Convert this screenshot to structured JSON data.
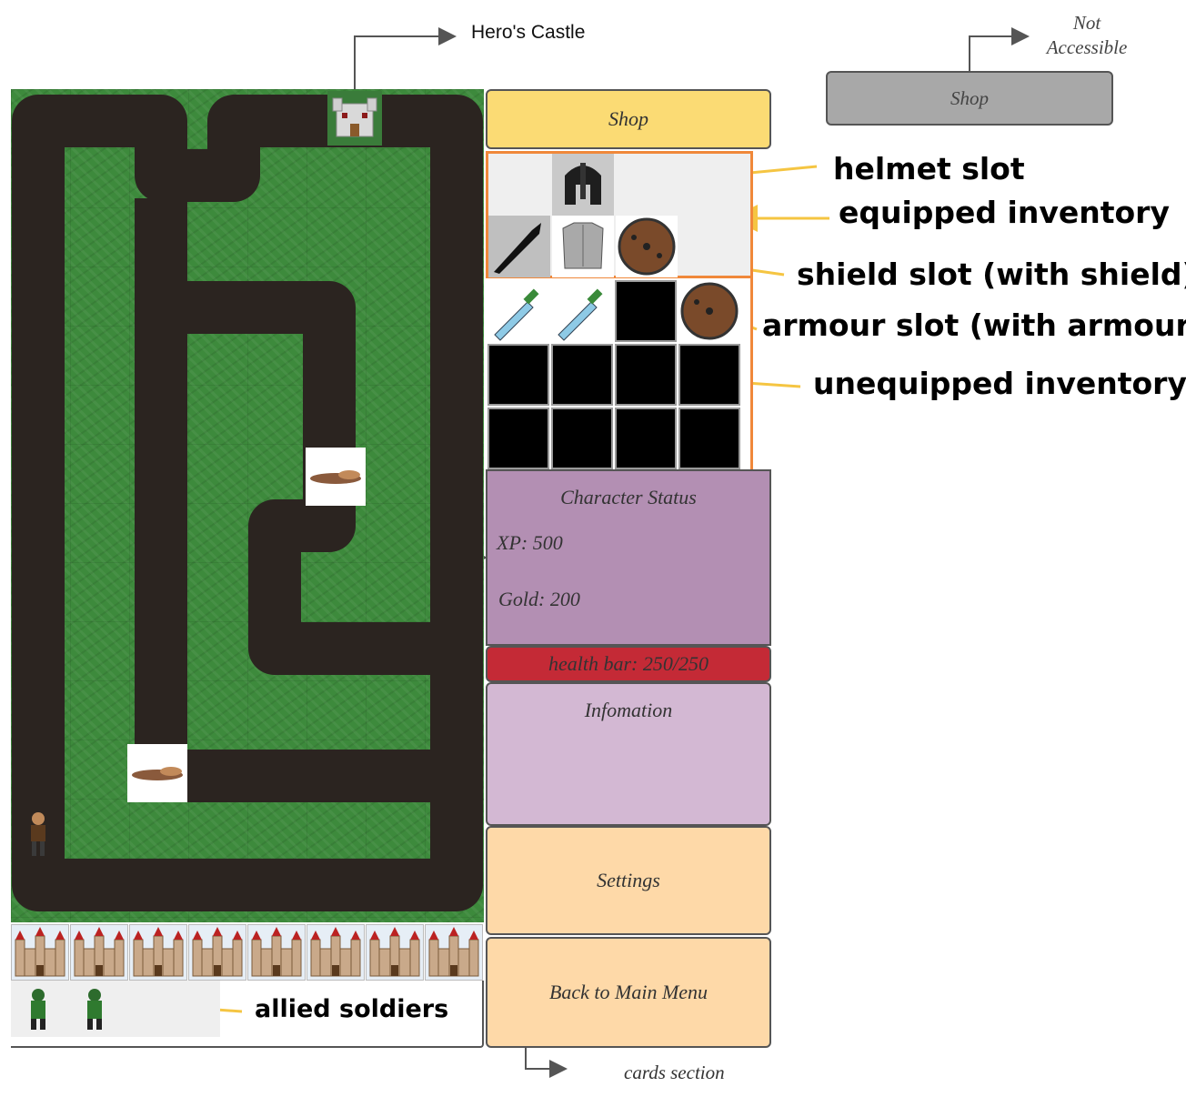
{
  "annotations": {
    "heros_castle": "Hero's Castle",
    "not_accessible_line1": "Not",
    "not_accessible_line2": "Accessible",
    "helmet_slot": "helmet slot",
    "equipped_inventory": "equipped inventory",
    "shield_slot": "shield slot (with shield)",
    "armour_slot": "armour slot (with armour)",
    "unequipped_inventory": "unequipped inventory",
    "allied_soldiers": "allied soldiers",
    "cards_section": "cards section"
  },
  "shop": {
    "active_label": "Shop",
    "disabled_label": "Shop"
  },
  "character_status": {
    "title": "Character Status",
    "xp": "XP: 500",
    "gold": "Gold: 200"
  },
  "health_bar": {
    "label": "health bar: 250/250",
    "current": 250,
    "max": 250
  },
  "information": {
    "title": "Infomation"
  },
  "buttons": {
    "settings": "Settings",
    "back_to_main_menu": "Back to Main Menu"
  },
  "colors": {
    "shop_active": "#fbdb74",
    "shop_disabled": "#a8a8a8",
    "status_panel": "#b38fb3",
    "health_bar": "#c42a36",
    "info_panel": "#d3b8d3",
    "menu_button": "#fed9a8",
    "inventory_border": "#f0883a",
    "arrow_annotation": "#f5c542",
    "grass": "#3d8a3c",
    "path": "#2b2420"
  },
  "icons": {
    "castle": "castle-icon",
    "helmet": "helmet-icon",
    "sword": "sword-icon",
    "armour": "armour-icon",
    "shield": "shield-icon",
    "dagger": "dagger-icon",
    "hero": "hero-icon",
    "slug": "slug-enemy-icon",
    "soldier": "soldier-icon"
  }
}
